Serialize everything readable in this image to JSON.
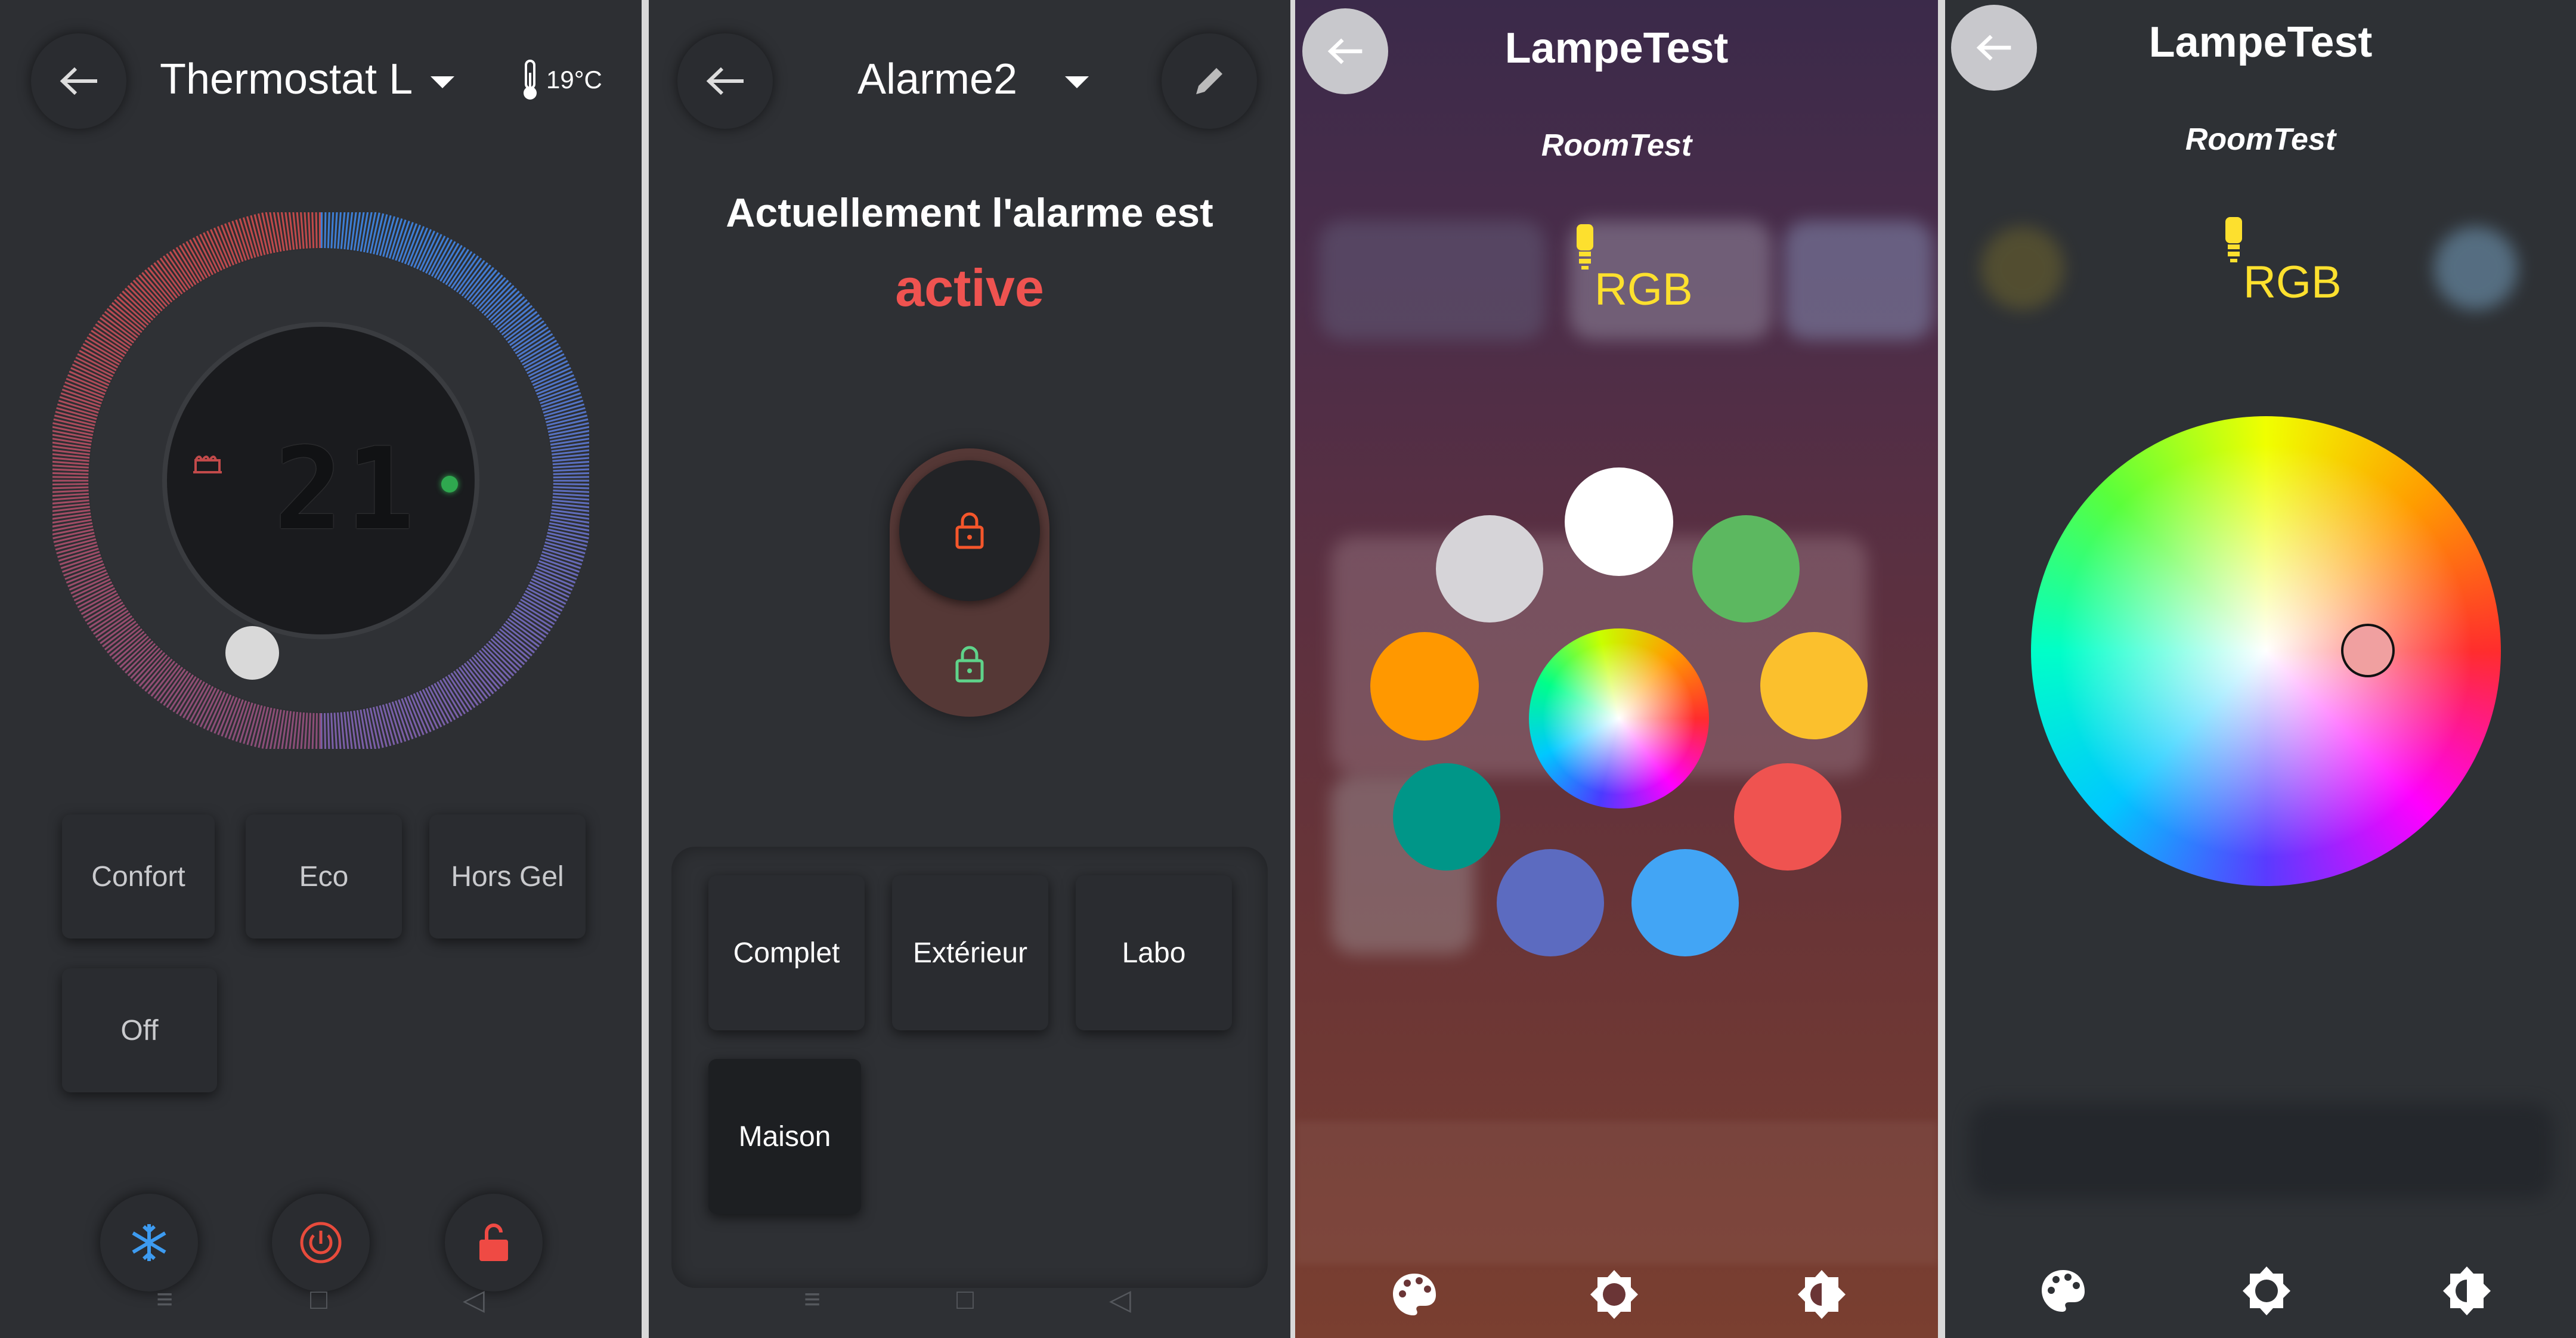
{
  "thermostat": {
    "title": "Thermostat L",
    "temperature": "19°C",
    "display_value": "21",
    "modes": [
      "Confort",
      "Eco",
      "Hors Gel",
      "Off"
    ],
    "bottom": [
      "snowflake-icon",
      "power-icon",
      "unlock-icon"
    ],
    "colors": {
      "heat": "#c24a4a",
      "cold": "#3d7fd6",
      "power": "#e84b3c"
    }
  },
  "alarm": {
    "title": "Alarme2",
    "status_line": "Actuellement l'alarme est",
    "status": "active",
    "modes": [
      "Complet",
      "Extérieur",
      "Labo",
      "Maison"
    ],
    "colors": {
      "active": "#ef5350",
      "lock": "#f4562b",
      "unlock": "#5fd38a"
    }
  },
  "lamp_presets": {
    "title": "LampeTest",
    "room": "RoomTest",
    "type": "RGB",
    "swatches": [
      "#ffffff",
      "#5cb860",
      "#fbc02d",
      "#ef5350",
      "#42a5f5",
      "#5c6bc0",
      "#009688",
      "#ff9800",
      "#d6d4d8"
    ]
  },
  "lamp_wheel": {
    "title": "LampeTest",
    "room": "RoomTest",
    "type": "RGB",
    "selected_color": "#f0a0a0"
  },
  "nav": {
    "menu": "≡",
    "home": "□",
    "back": "◁"
  }
}
